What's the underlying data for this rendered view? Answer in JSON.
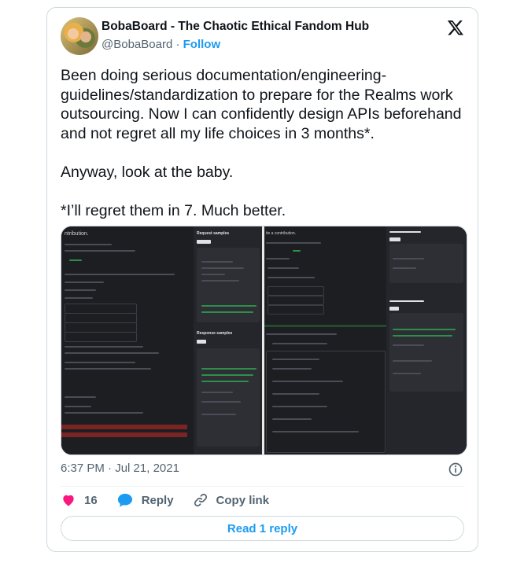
{
  "author": {
    "display_name": "BobaBoard - The Chaotic Ethical Fandom Hub",
    "handle": "@BobaBoard",
    "separator": "·",
    "follow_label": "Follow"
  },
  "icons": {
    "platform": "x-logo-icon",
    "info": "info-icon",
    "like": "heart-icon",
    "reply": "speech-bubble-icon",
    "copy_link": "link-icon"
  },
  "tweet": {
    "text": "Been doing serious documentation/engineering-guidelines/standardization to prepare for the Realms work outsourcing. Now I can confidently design APIs beforehand and not regret all my life choices in 3 months*.\n\nAnyway, look at the baby.\n\n*I’ll regret them in 7. Much better."
  },
  "media": {
    "left_heading": "ntribution.",
    "request_samples": "Request samples",
    "response_samples": "Response samples",
    "right_heading": "ite a contribution."
  },
  "meta": {
    "time": "6:37 PM",
    "separator": "·",
    "date": "Jul 21, 2021"
  },
  "actions": {
    "like_count": "16",
    "reply_label": "Reply",
    "copy_link_label": "Copy link"
  },
  "footer": {
    "read_replies_label": "Read 1 reply"
  },
  "colors": {
    "accent": "#1d9bf0",
    "like": "#f91880",
    "text": "#0f1419",
    "muted": "#536471",
    "border": "#cfd9de"
  }
}
